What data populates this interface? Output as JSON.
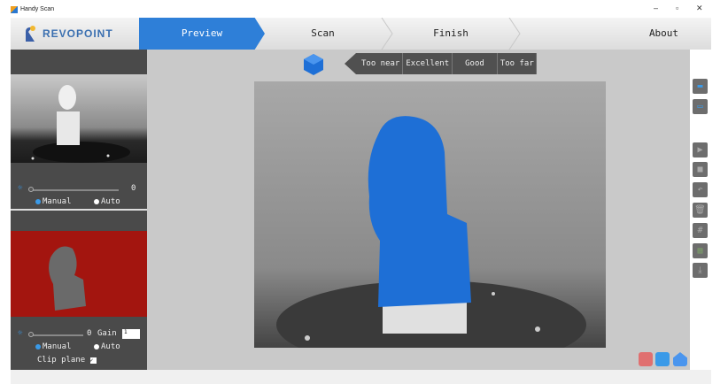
{
  "window": {
    "title": "Handy Scan",
    "minimize": "–",
    "maximize": "▫",
    "close": "✕"
  },
  "header": {
    "logo": "REVOPOINT",
    "steps": [
      {
        "label": "Preview",
        "active": true
      },
      {
        "label": "Scan",
        "active": false
      },
      {
        "label": "Finish",
        "active": false
      }
    ],
    "about": "About"
  },
  "left_panel": {
    "depth_camera": {
      "value": "0",
      "modes": [
        "Manual",
        "Auto"
      ],
      "selected": "Manual"
    },
    "rgb_camera": {
      "value": "0",
      "gain_label": "Gain",
      "gain_value": "1",
      "modes": [
        "Manual",
        "Auto"
      ],
      "selected": "Manual",
      "clip_plane_label": "Clip plane",
      "clip_plane_checked": true
    }
  },
  "distance_indicator": {
    "labels": [
      "Too near",
      "Excellent",
      "Good",
      "Too far"
    ]
  },
  "toolbar": {
    "icons": [
      "open-folder-icon",
      "open-file-icon",
      "play-icon",
      "stop-icon",
      "undo-icon",
      "delete-icon",
      "grid-icon",
      "texture-icon",
      "export-icon"
    ]
  },
  "status_icons": [
    "lock-icon",
    "rgb-monitor-icon",
    "home-icon"
  ],
  "colors": {
    "accent": "#2e7fd8",
    "scan_blue": "#1e6fd6",
    "rgb_bg": "#a3150f"
  }
}
